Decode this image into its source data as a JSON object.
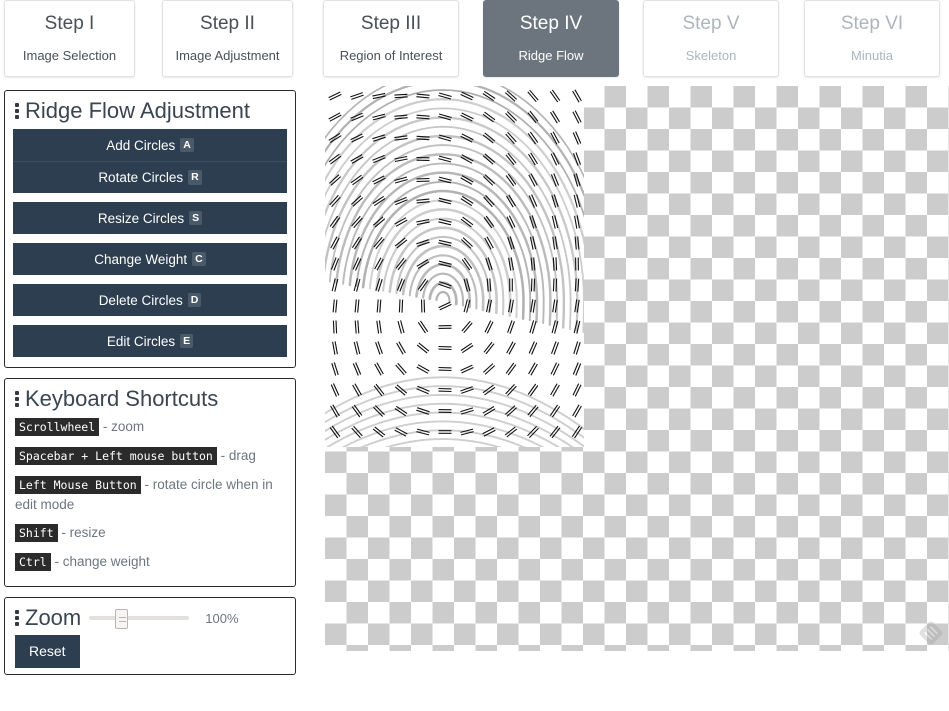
{
  "steps": [
    {
      "num": "Step I",
      "label": "Image Selection",
      "state": "enabled"
    },
    {
      "num": "Step II",
      "label": "Image Adjustment",
      "state": "enabled"
    },
    {
      "num": "Step III",
      "label": "Region of Interest",
      "state": "enabled"
    },
    {
      "num": "Step IV",
      "label": "Ridge Flow",
      "state": "active"
    },
    {
      "num": "Step V",
      "label": "Skeleton",
      "state": "disabled"
    },
    {
      "num": "Step VI",
      "label": "Minutia",
      "state": "disabled"
    }
  ],
  "ridge_flow_panel": {
    "title": "Ridge Flow Adjustment",
    "buttons": [
      {
        "label": "Add Circles",
        "key": "A"
      },
      {
        "label": "Rotate Circles",
        "key": "R"
      },
      {
        "label": "Resize Circles",
        "key": "S"
      },
      {
        "label": "Change Weight",
        "key": "C"
      },
      {
        "label": "Delete Circles",
        "key": "D"
      },
      {
        "label": "Edit Circles",
        "key": "E"
      }
    ]
  },
  "shortcuts_panel": {
    "title": "Keyboard Shortcuts",
    "rows": [
      {
        "keys": "Scrollwheel",
        "desc": " - zoom"
      },
      {
        "keys": "Spacebar + Left mouse button",
        "desc": " - drag"
      },
      {
        "keys": "Left Mouse Button",
        "desc": " - rotate circle when in edit mode"
      },
      {
        "keys": "Shift",
        "desc": " - resize"
      },
      {
        "keys": "Ctrl",
        "desc": " - change weight"
      }
    ]
  },
  "zoom_panel": {
    "title": "Zoom",
    "percent": "100%",
    "slider_value": 100,
    "reset_label": "Reset"
  },
  "canvas": {
    "image_alt": "fingerprint-ridge-flow-overlay"
  },
  "colors": {
    "button_bg": "#2c3e50",
    "active_tab_bg": "#6c757d",
    "panel_border": "#2b2b2b",
    "kbd_bg": "#2b2b2b",
    "muted_text": "#adb5bd"
  }
}
